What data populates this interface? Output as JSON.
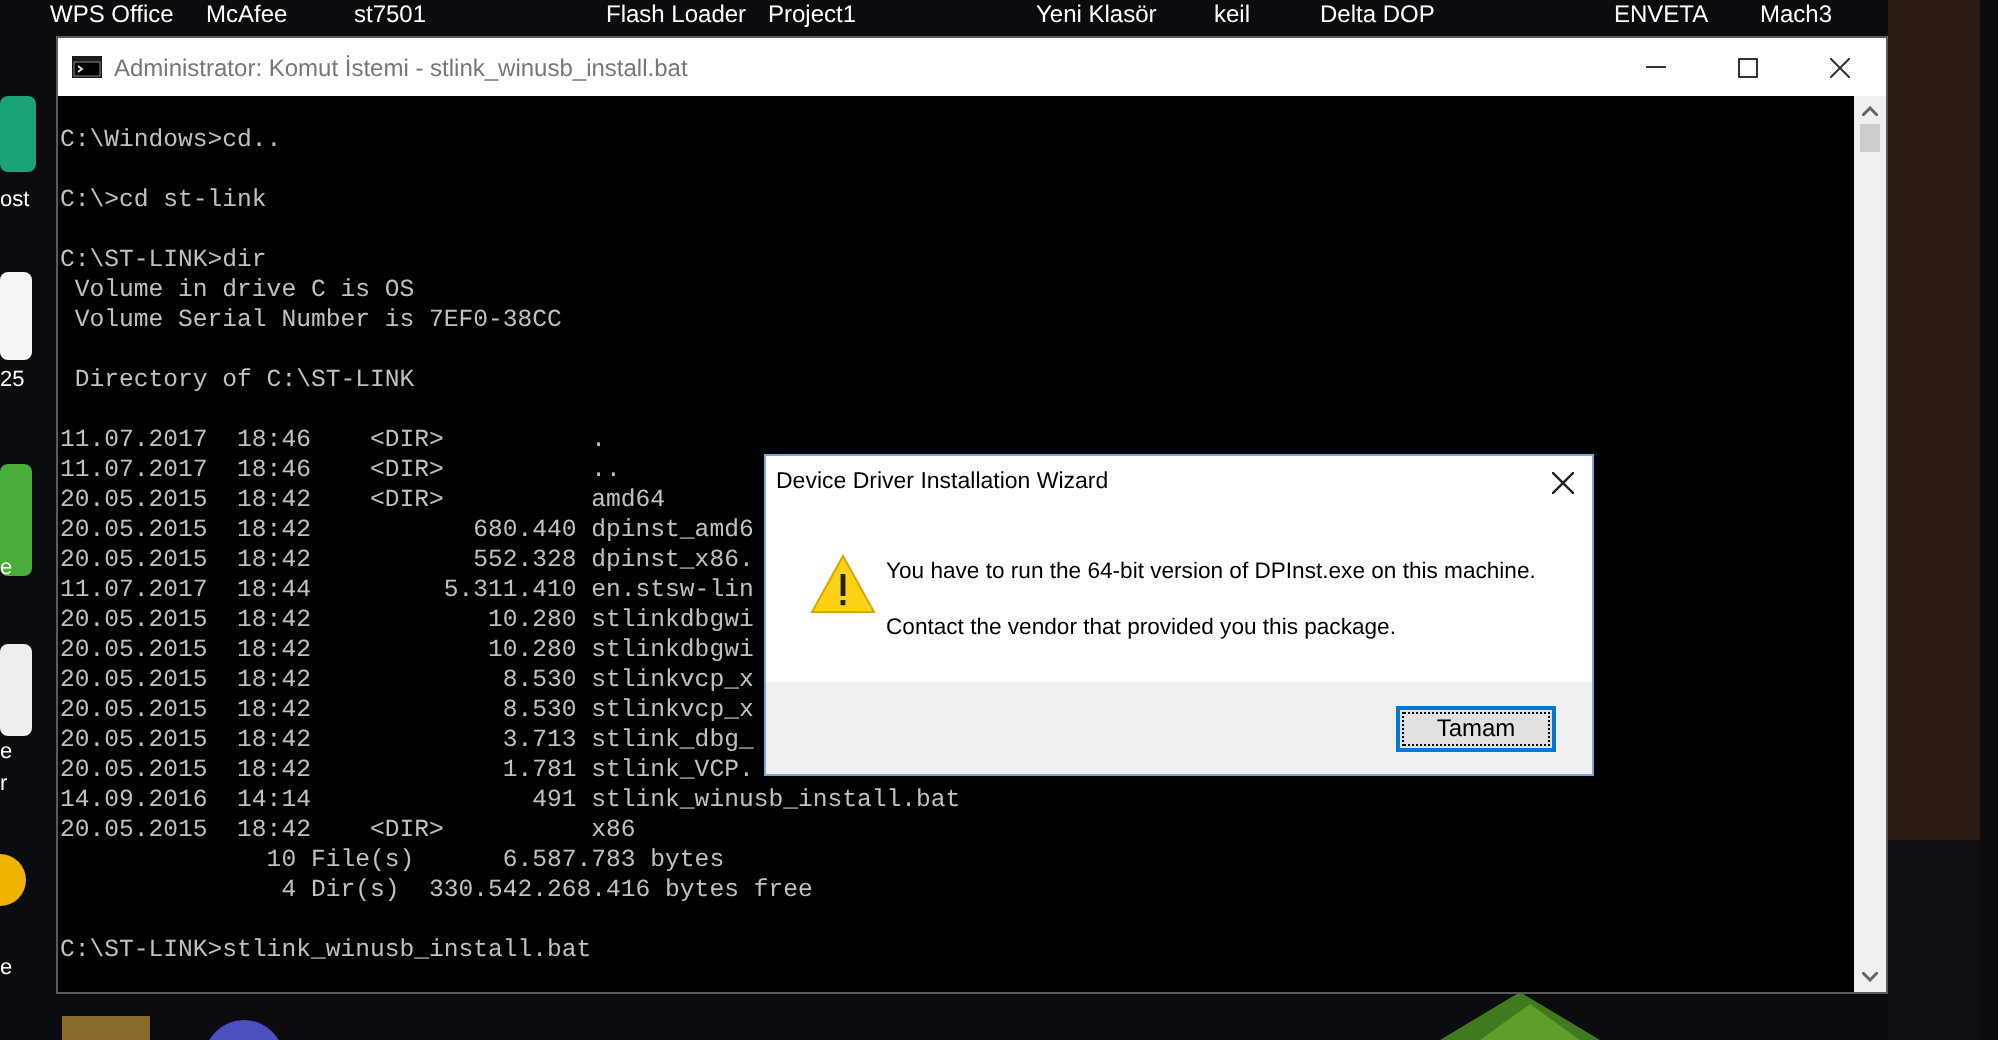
{
  "desktop": {
    "top_labels": [
      "WPS Office",
      "McAfee",
      "st7501",
      "Flash Loader",
      "Project1",
      "Yeni Klasör",
      "keil",
      "Delta DOP",
      "ENVETA",
      "Mach3"
    ],
    "left_labels": [
      "ost",
      "25",
      "e",
      "e",
      "r",
      "e"
    ]
  },
  "console": {
    "title": "Administrator: Komut İstemi - stlink_winusb_install.bat",
    "blocks": [
      [
        "C:\\Windows>cd.."
      ],
      [
        "C:\\>cd st-link"
      ],
      [
        "C:\\ST-LINK>dir",
        " Volume in drive C is OS",
        " Volume Serial Number is 7EF0-38CC"
      ],
      [
        " Directory of C:\\ST-LINK"
      ],
      [
        "11.07.2017  18:46    <DIR>          .",
        "11.07.2017  18:46    <DIR>          ..",
        "20.05.2015  18:42    <DIR>          amd64",
        "20.05.2015  18:42           680.440 dpinst_amd6",
        "20.05.2015  18:42           552.328 dpinst_x86.",
        "11.07.2017  18:44         5.311.410 en.stsw-lin",
        "20.05.2015  18:42            10.280 stlinkdbgwi",
        "20.05.2015  18:42            10.280 stlinkdbgwi",
        "20.05.2015  18:42             8.530 stlinkvcp_x",
        "20.05.2015  18:42             8.530 stlinkvcp_x",
        "20.05.2015  18:42             3.713 stlink_dbg_",
        "20.05.2015  18:42             1.781 stlink_VCP.",
        "14.09.2016  14:14               491 stlink_winusb_install.bat",
        "20.05.2015  18:42    <DIR>          x86",
        "              10 File(s)      6.587.783 bytes",
        "               4 Dir(s)  330.542.268.416 bytes free"
      ],
      [
        "C:\\ST-LINK>stlink_winusb_install.bat"
      ]
    ]
  },
  "dialog": {
    "title": "Device Driver Installation Wizard",
    "messages": [
      "You have to run the 64-bit version of DPInst.exe on this machine.",
      "Contact the vendor that provided you this package."
    ],
    "buttons": [
      {
        "label": "Tamam",
        "selected": true
      }
    ]
  }
}
